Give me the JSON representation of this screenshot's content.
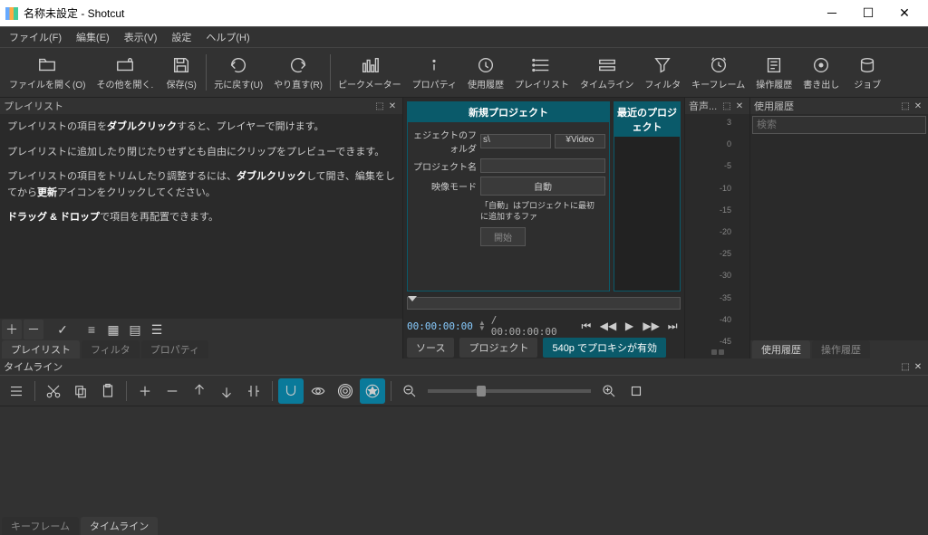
{
  "title": "名称未設定 - Shotcut",
  "menu": {
    "file": "ファイル(F)",
    "edit": "編集(E)",
    "view": "表示(V)",
    "settings": "設定",
    "help": "ヘルプ(H)"
  },
  "toolbar": {
    "open": "ファイルを開く(O)",
    "open_other": "その他を開く.",
    "save": "保存(S)",
    "undo": "元に戻す(U)",
    "redo": "やり直す(R)",
    "peak_meter": "ピークメーター",
    "properties": "プロパティ",
    "history_use": "使用履歴",
    "playlist": "プレイリスト",
    "timeline": "タイムライン",
    "filter": "フィルタ",
    "keyframes": "キーフレーム",
    "op_history": "操作履歴",
    "export": "書き出し",
    "jobs": "ジョブ"
  },
  "playlist": {
    "header": "プレイリスト",
    "inst1_a": "プレイリストの項目を",
    "inst1_b": "ダブルクリック",
    "inst1_c": "すると、プレイヤーで開けます。",
    "inst2": "プレイリストに追加したり閉じたりせずとも自由にクリップをプレビューできます。",
    "inst3_a": "プレイリストの項目をトリムしたり調整するには、",
    "inst3_b": "ダブルクリック",
    "inst3_c": "して開き、編集をしてから",
    "inst3_d": "更新",
    "inst3_e": "アイコンをクリックしてください。",
    "inst4_a": "ドラッグ & ドロップ",
    "inst4_b": "で項目を再配置できます。",
    "tab_playlist": "プレイリスト",
    "tab_filter": "フィルタ",
    "tab_property": "プロパティ"
  },
  "project": {
    "new_title": "新規プロジェクト",
    "recent_title": "最近のプロジェクト",
    "folder_label": "ェジェクトのフォルダ",
    "folder_value": "s\\",
    "folder_btn": "¥Video",
    "name_label": "プロジェクト名",
    "name_value": "",
    "mode_label": "映像モード",
    "mode_btn": "自動",
    "note": "「自動」はプロジェクトに最初に追加するファ",
    "start": "開始",
    "timecode_cur": "00:00:00:00",
    "timecode_total": "/ 00:00:00:00",
    "tab_source": "ソース",
    "tab_project": "プロジェクト",
    "tab_proxy": "540p でプロキシが有効"
  },
  "audio": {
    "header_a": "音声...",
    "levels": [
      "3",
      "0",
      "-5",
      "-10",
      "-15",
      "-20",
      "-25",
      "-30",
      "-35",
      "-40",
      "-45"
    ]
  },
  "history": {
    "header": "使用履歴",
    "search_placeholder": "検索",
    "tab_use": "使用履歴",
    "tab_op": "操作履歴"
  },
  "timeline": {
    "header": "タイムライン",
    "tab_keyframe": "キーフレーム",
    "tab_timeline": "タイムライン"
  }
}
